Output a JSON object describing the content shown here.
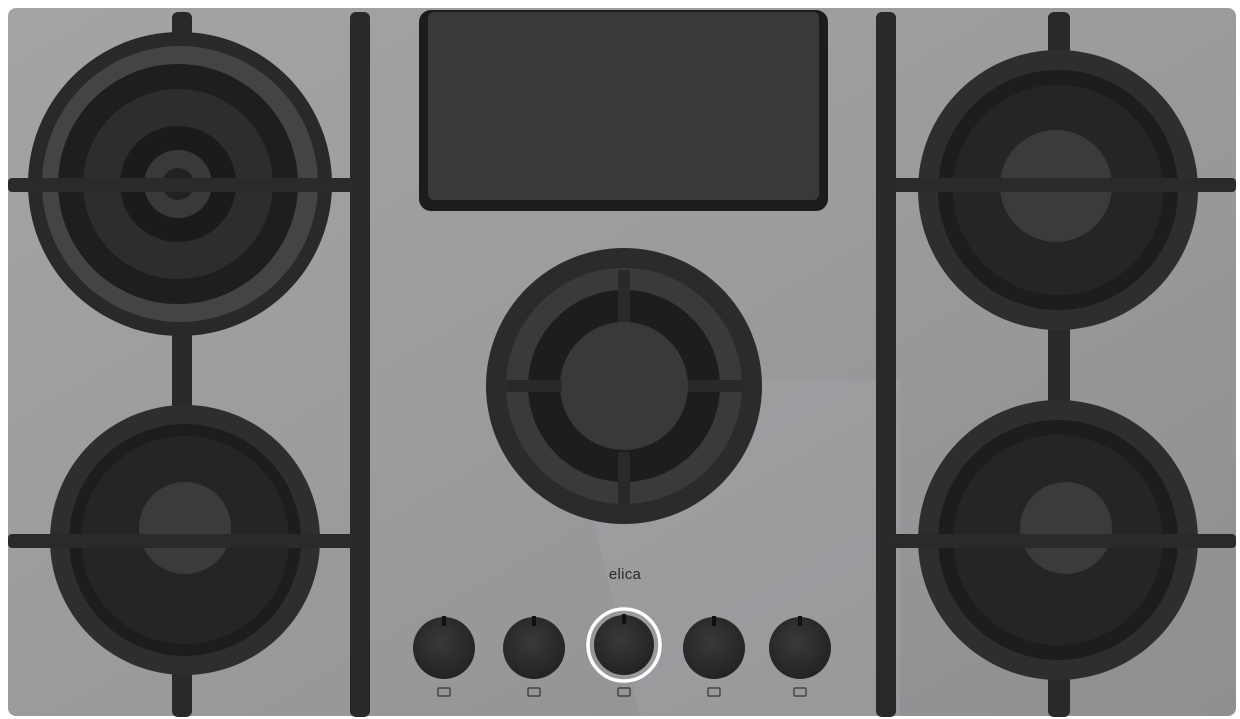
{
  "hob": {
    "brand": "elica",
    "colors": {
      "glass": "#98999b",
      "iron": "#2b2a2a",
      "burner_cap": "#3f3e3e",
      "ring_light": "#ffffff"
    },
    "burners": [
      {
        "id": "back-left-wok",
        "icon": "wok-burner-icon"
      },
      {
        "id": "front-left",
        "icon": "burner-icon"
      },
      {
        "id": "center",
        "icon": "burner-icon"
      },
      {
        "id": "back-right",
        "icon": "burner-icon"
      },
      {
        "id": "front-right",
        "icon": "burner-icon"
      }
    ],
    "knobs": [
      {
        "id": "knob-1",
        "lit": false,
        "indicator_icon": "front-left-zone-icon"
      },
      {
        "id": "knob-2",
        "lit": false,
        "indicator_icon": "back-left-zone-icon"
      },
      {
        "id": "knob-3",
        "lit": true,
        "indicator_icon": "center-zone-icon"
      },
      {
        "id": "knob-4",
        "lit": false,
        "indicator_icon": "back-right-zone-icon"
      },
      {
        "id": "knob-5",
        "lit": false,
        "indicator_icon": "front-right-zone-icon"
      }
    ],
    "extractor_vent": {
      "icon": "extractor-vent-icon"
    }
  }
}
